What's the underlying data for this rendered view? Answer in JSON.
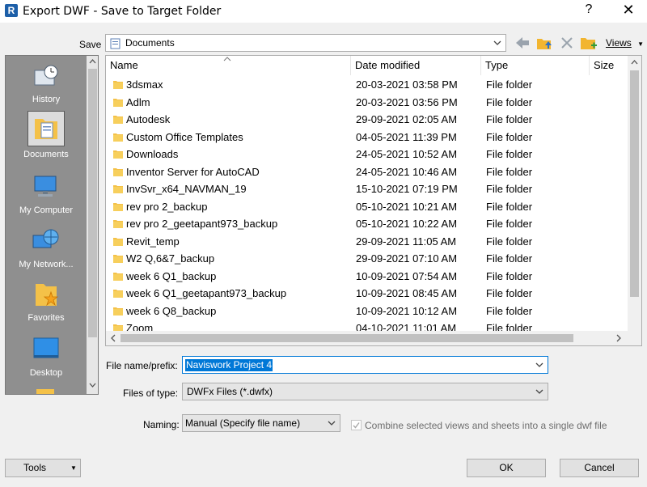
{
  "window": {
    "app_icon_letter": "R",
    "title": "Export DWF - Save to Target Folder",
    "help": "?",
    "close": "✕"
  },
  "save_in": {
    "label": "Save",
    "value": "Documents"
  },
  "toolbar": {
    "views_label": "Views"
  },
  "places": [
    {
      "label": "History"
    },
    {
      "label": "Documents"
    },
    {
      "label": "My Computer"
    },
    {
      "label": "My Network..."
    },
    {
      "label": "Favorites"
    },
    {
      "label": "Desktop"
    }
  ],
  "columns": [
    "Name",
    "Date modified",
    "Type",
    "Size"
  ],
  "files": [
    {
      "name": "3dsmax",
      "date": "20-03-2021 03:58 PM",
      "type": "File folder"
    },
    {
      "name": "Adlm",
      "date": "20-03-2021 03:56 PM",
      "type": "File folder"
    },
    {
      "name": "Autodesk",
      "date": "29-09-2021 02:05 AM",
      "type": "File folder"
    },
    {
      "name": "Custom Office Templates",
      "date": "04-05-2021 11:39 PM",
      "type": "File folder"
    },
    {
      "name": "Downloads",
      "date": "24-05-2021 10:52 AM",
      "type": "File folder"
    },
    {
      "name": "Inventor Server for AutoCAD",
      "date": "24-05-2021 10:46 AM",
      "type": "File folder"
    },
    {
      "name": "InvSvr_x64_NAVMAN_19",
      "date": "15-10-2021 07:19 PM",
      "type": "File folder"
    },
    {
      "name": "rev pro 2_backup",
      "date": "05-10-2021 10:21 AM",
      "type": "File folder"
    },
    {
      "name": "rev pro 2_geetapant973_backup",
      "date": "05-10-2021 10:22 AM",
      "type": "File folder"
    },
    {
      "name": "Revit_temp",
      "date": "29-09-2021 11:05 AM",
      "type": "File folder"
    },
    {
      "name": "W2 Q,6&7_backup",
      "date": "29-09-2021 07:10 AM",
      "type": "File folder"
    },
    {
      "name": "week 6 Q1_backup",
      "date": "10-09-2021 07:54 AM",
      "type": "File folder"
    },
    {
      "name": "week 6 Q1_geetapant973_backup",
      "date": "10-09-2021 08:45 AM",
      "type": "File folder"
    },
    {
      "name": "week 6 Q8_backup",
      "date": "10-09-2021 10:12 AM",
      "type": "File folder"
    },
    {
      "name": "Zoom",
      "date": "04-10-2021 11:01 AM",
      "type": "File folder"
    }
  ],
  "form": {
    "filename_label": "File name/prefix:",
    "filename_value": "Naviswork Project 4",
    "filetype_label": "Files of type:",
    "filetype_value": "DWFx Files (*.dwfx)",
    "naming_label": "Naming:",
    "naming_value": "Manual (Specify file name)",
    "combine_label": "Combine selected views and sheets into a single dwf file",
    "combine_checked": true
  },
  "buttons": {
    "tools": "Tools",
    "ok": "OK",
    "cancel": "Cancel"
  }
}
